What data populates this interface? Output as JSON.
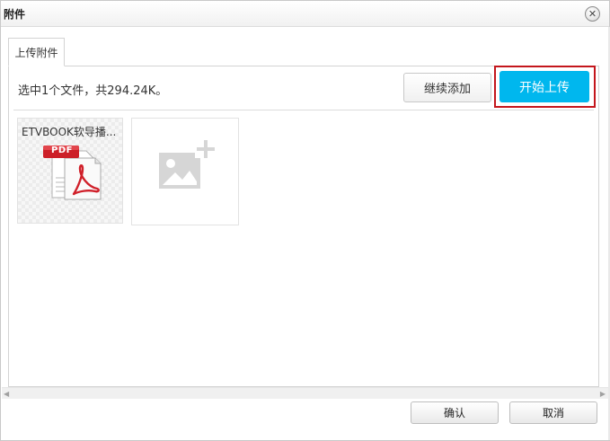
{
  "dialog": {
    "title": "附件",
    "close_icon": "close-icon"
  },
  "tabs": [
    {
      "label": "上传附件",
      "active": true
    }
  ],
  "uploader": {
    "status": "选中1个文件，共294.24K。",
    "continue_label": "继续添加",
    "upload_label": "开始上传",
    "upload_color": "#00b7ee",
    "highlight_color": "#c4161c"
  },
  "files": [
    {
      "name": "ETVBOOK软导播...",
      "type_label": "PDF",
      "icon": "pdf-file-icon"
    }
  ],
  "add_tile": {
    "icon": "add-image-icon"
  },
  "footer": {
    "ok_label": "确认",
    "cancel_label": "取消"
  }
}
